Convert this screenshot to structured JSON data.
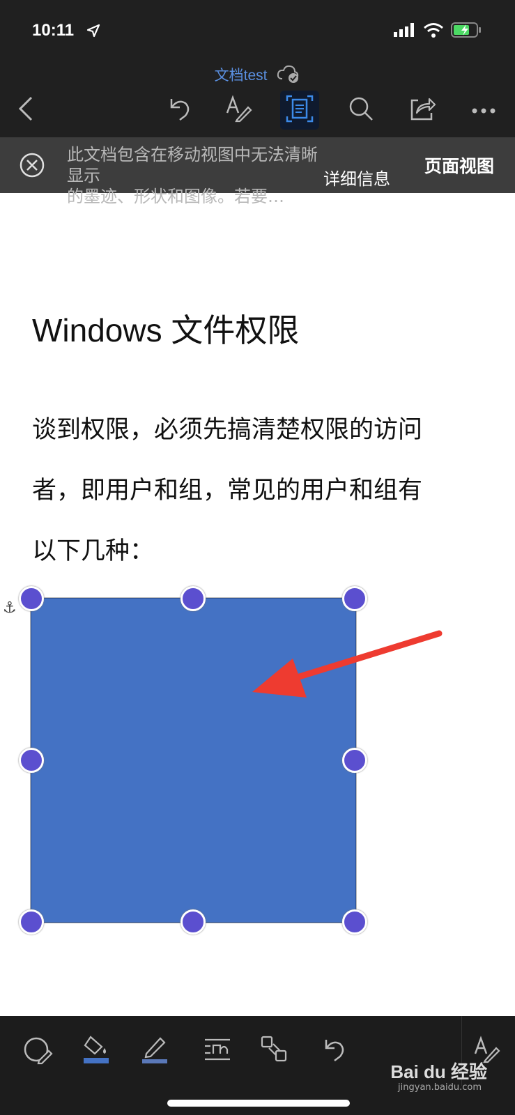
{
  "status": {
    "time": "10:11"
  },
  "header": {
    "doc_title": "文档test"
  },
  "banner": {
    "message_line1": "此文档包含在移动视图中无法清晰显示",
    "message_line2": "的墨迹、形状和图像。若要…",
    "more_label": "详细信息",
    "page_view_label": "页面视图"
  },
  "document": {
    "heading": "Windows 文件权限",
    "paragraph_lines": [
      "谈到权限，必须先搞清楚权限的访问",
      "者，即用户和组，常见的用户和组有",
      "以下几种："
    ],
    "shape_color": "#4472c4"
  },
  "watermark": {
    "brand": "Bai du 经验",
    "url": "jingyan.baidu.com"
  }
}
